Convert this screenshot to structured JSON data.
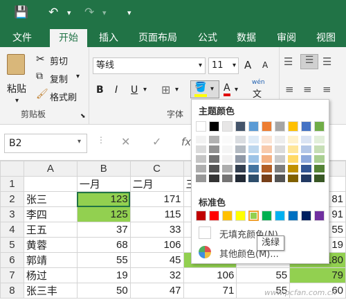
{
  "qat": {
    "save_icon": "💾",
    "undo_icon": "↶",
    "redo_icon": "↷",
    "customize_icon": "▾"
  },
  "tabs": [
    "文件",
    "开始",
    "插入",
    "页面布局",
    "公式",
    "数据",
    "审阅",
    "视图"
  ],
  "ribbon": {
    "clipboard": {
      "paste": "粘贴",
      "cut": "剪切",
      "copy": "复制",
      "format_painter": "格式刷",
      "label": "剪贴板"
    },
    "font": {
      "name": "等线",
      "size": "11",
      "bold": "B",
      "italic": "I",
      "underline": "U",
      "grow": "A",
      "shrink": "A",
      "wen": "wén",
      "label": "字体"
    }
  },
  "formula_bar": {
    "namebox": "B2",
    "cancel": "✕",
    "enter": "✓",
    "fx": "fx"
  },
  "sheet": {
    "col_headers": [
      "A",
      "B",
      "C"
    ],
    "rows": [
      {
        "n": "1",
        "a": "",
        "b": "一月",
        "c": "二月",
        "d": "三",
        "e": "",
        "f": ""
      },
      {
        "n": "2",
        "a": "张三",
        "b": "123",
        "c": "171",
        "d": "",
        "e": "",
        "f": "81"
      },
      {
        "n": "3",
        "a": "李四",
        "b": "125",
        "c": "115",
        "d": "",
        "e": "",
        "f": "91"
      },
      {
        "n": "4",
        "a": "王五",
        "b": "37",
        "c": "33",
        "d": "",
        "e": "",
        "f": "55"
      },
      {
        "n": "5",
        "a": "黄蓉",
        "b": "68",
        "c": "106",
        "d": "",
        "e": "",
        "f": "19"
      },
      {
        "n": "6",
        "a": "郭靖",
        "b": "55",
        "c": "45",
        "d": "146",
        "e": "45",
        "f": "180"
      },
      {
        "n": "7",
        "a": "杨过",
        "b": "19",
        "c": "32",
        "d": "106",
        "e": "55",
        "f": "79"
      },
      {
        "n": "8",
        "a": "张三丰",
        "b": "50",
        "c": "47",
        "d": "71",
        "e": "55",
        "f": "60"
      }
    ]
  },
  "color_menu": {
    "theme_title": "主题颜色",
    "standard_title": "标准色",
    "no_fill": "无填充颜色(N)",
    "more_colors": "其他颜色(M)...",
    "tooltip": "浅绿",
    "theme_row": [
      "#ffffff",
      "#000000",
      "#e7e6e6",
      "#44546a",
      "#5b9bd5",
      "#ed7d31",
      "#a5a5a5",
      "#ffc000",
      "#4472c4",
      "#70ad47"
    ],
    "standard_row": [
      "#c00000",
      "#ff0000",
      "#ffc000",
      "#ffff00",
      "#92d050",
      "#00b050",
      "#00b0f0",
      "#0070c0",
      "#002060",
      "#7030a0"
    ]
  },
  "watermark": "www.pcfan.com.cn"
}
